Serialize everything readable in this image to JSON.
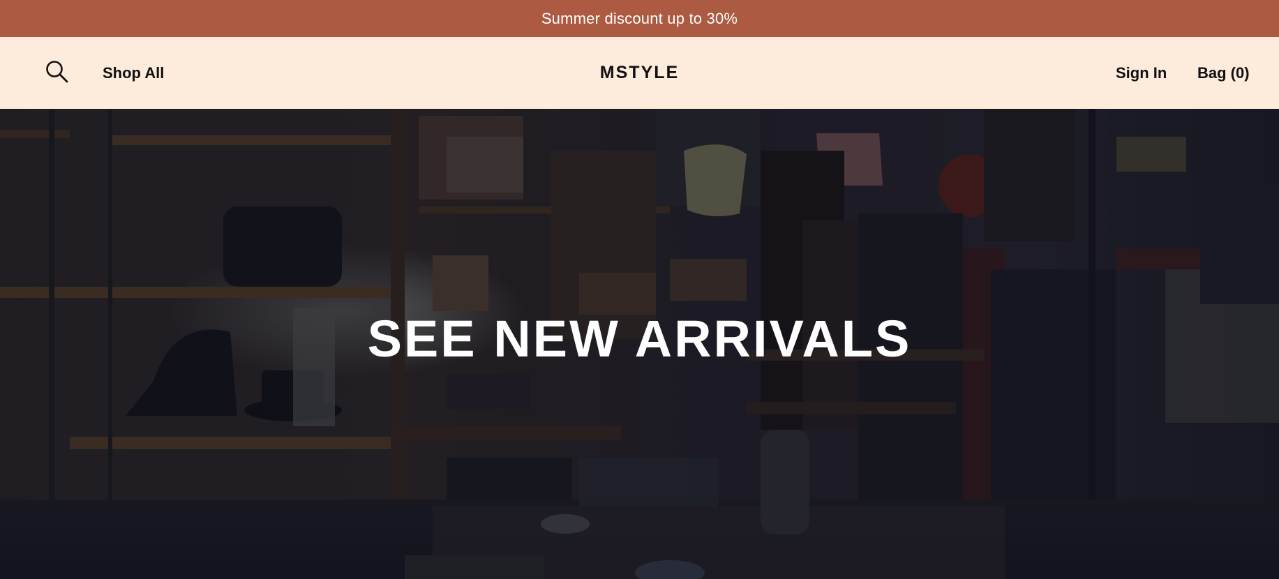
{
  "announcement": {
    "text": "Summer discount up to 30%"
  },
  "header": {
    "search_icon": "search-icon",
    "shop_all_label": "Shop All",
    "brand": "MSTYLE",
    "sign_in_label": "Sign In",
    "bag_label": "Bag (0)"
  },
  "hero": {
    "title": "SEE NEW ARRIVALS",
    "image_description_icon": "store-interior-image"
  },
  "colors": {
    "announcement_bg": "#ac5a42",
    "header_bg": "#fdecdb",
    "text_dark": "#111111",
    "hero_text": "#ffffff"
  }
}
